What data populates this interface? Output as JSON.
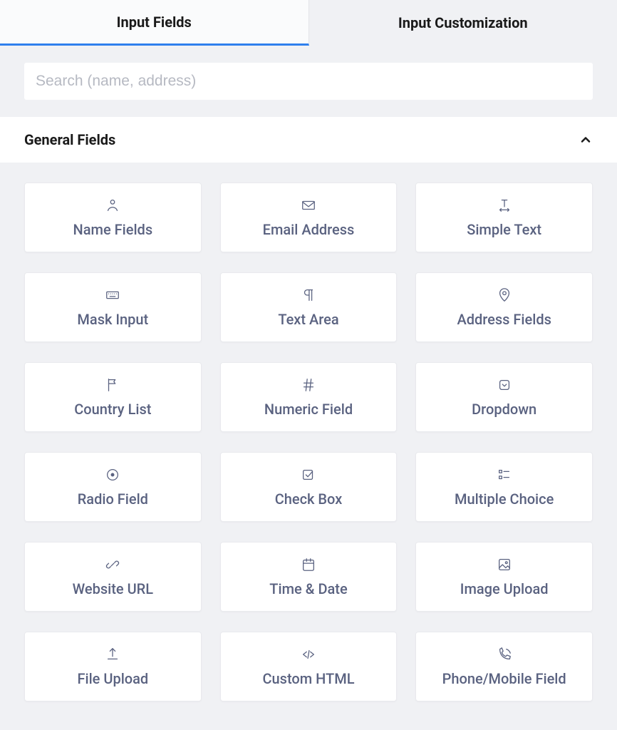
{
  "tabs": {
    "active": "Input Fields",
    "inactive": "Input Customization"
  },
  "search": {
    "placeholder": "Search (name, address)",
    "value": ""
  },
  "section": {
    "title": "General Fields"
  },
  "fields": [
    {
      "label": "Name Fields",
      "icon": "user-icon"
    },
    {
      "label": "Email Address",
      "icon": "mail-icon"
    },
    {
      "label": "Simple Text",
      "icon": "text-width-icon"
    },
    {
      "label": "Mask Input",
      "icon": "keyboard-icon"
    },
    {
      "label": "Text Area",
      "icon": "paragraph-icon"
    },
    {
      "label": "Address Fields",
      "icon": "pin-icon"
    },
    {
      "label": "Country List",
      "icon": "flag-icon"
    },
    {
      "label": "Numeric Field",
      "icon": "hash-icon"
    },
    {
      "label": "Dropdown",
      "icon": "dropdown-icon"
    },
    {
      "label": "Radio Field",
      "icon": "radio-icon"
    },
    {
      "label": "Check Box",
      "icon": "checkbox-icon"
    },
    {
      "label": "Multiple Choice",
      "icon": "list-icon"
    },
    {
      "label": "Website URL",
      "icon": "link-icon"
    },
    {
      "label": "Time & Date",
      "icon": "calendar-icon"
    },
    {
      "label": "Image Upload",
      "icon": "image-icon"
    },
    {
      "label": "File Upload",
      "icon": "upload-icon"
    },
    {
      "label": "Custom HTML",
      "icon": "code-icon"
    },
    {
      "label": "Phone/Mobile Field",
      "icon": "phone-icon"
    }
  ]
}
